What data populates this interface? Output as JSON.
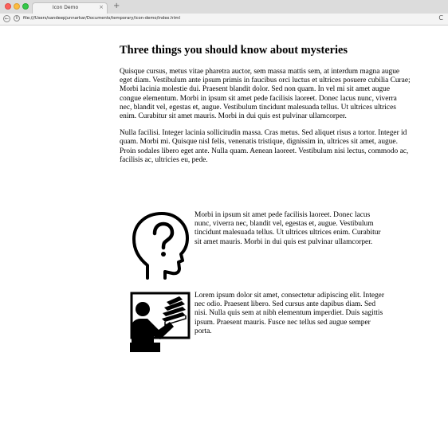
{
  "browser": {
    "tab_title": "Icon Demo",
    "tab_close": "×",
    "new_tab": "+",
    "url": "file:///Users/sandeepjunnarkar/Documents/temporary/icon-demo/index.html",
    "reload": "C"
  },
  "page": {
    "heading": "Three things you should know about mysteries",
    "paragraphs": [
      "Quisque cursus, metus vitae pharetra auctor, sem massa mattis sem, at interdum magna augue eget diam. Vestibulum ante ipsum primis in faucibus orci luctus et ultrices posuere cubilia Curae; Morbi lacinia molestie dui. Praesent blandit dolor. Sed non quam. In vel mi sit amet augue congue elementum. Morbi in ipsum sit amet pede facilisis laoreet. Donec lacus nunc, viverra nec, blandit vel, egestas et, augue. Vestibulum tincidunt malesuada tellus. Ut ultrices ultrices enim. Curabitur sit amet mauris. Morbi in dui quis est pulvinar ullamcorper.",
      "Nulla facilisi. Integer lacinia sollicitudin massa. Cras metus. Sed aliquet risus a tortor. Integer id quam. Morbi mi. Quisque nisl felis, venenatis tristique, dignissim in, ultrices sit amet, augue. Proin sodales libero eget ante. Nulla quam. Aenean laoreet. Vestibulum nisi lectus, commodo ac, facilisis ac, ultricies eu, pede."
    ],
    "media": [
      {
        "icon": "head-question-icon",
        "text": "Morbi in ipsum sit amet pede facilisis laoreet. Donec lacus nunc, viverra nec, blandit vel, egestas et, augue. Vestibulum tincidunt malesuada tellus. Ut ultrices ultrices enim. Curabitur sit amet mauris. Morbi in dui quis est pulvinar ullamcorper."
      },
      {
        "icon": "teacher-books-icon",
        "text": "Lorem ipsum dolor sit amet, consectetur adipiscing elit. Integer nec odio. Praesent libero. Sed cursus ante dapibus diam. Sed nisi. Nulla quis sem at nibh elementum imperdiet. Duis sagittis ipsum. Praesent mauris. Fusce nec tellus sed augue semper porta."
      }
    ]
  }
}
